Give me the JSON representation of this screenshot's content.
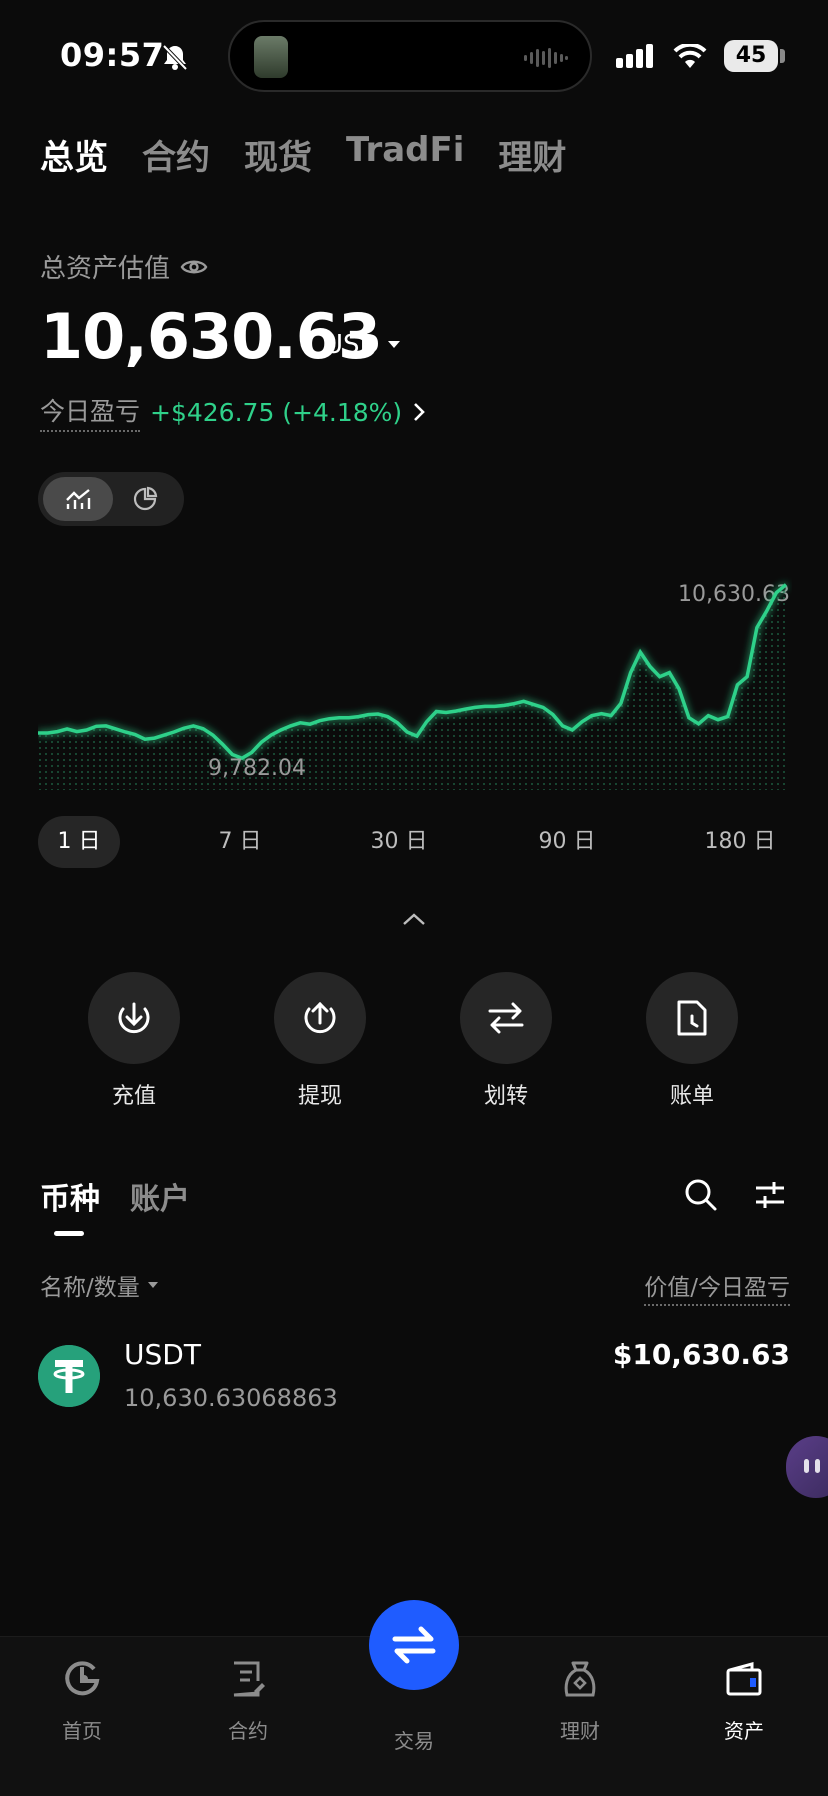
{
  "status_bar": {
    "time": "09:57",
    "battery": "45"
  },
  "top_tabs": [
    {
      "label": "总览",
      "active": true
    },
    {
      "label": "合约",
      "active": false
    },
    {
      "label": "现货",
      "active": false
    },
    {
      "label": "TradFi",
      "active": false
    },
    {
      "label": "理财",
      "active": false
    }
  ],
  "overview": {
    "total_label": "总资产估值",
    "total_value": "10,630.63",
    "currency": "USD",
    "pnl_label": "今日盈亏",
    "pnl_value": "+$426.75 (+4.18%)"
  },
  "chart_data": {
    "type": "line",
    "max_label": "10,630.63",
    "min_label": "9,782.04",
    "values": [
      9905,
      9905,
      9912,
      9925,
      9912,
      9920,
      9938,
      9940,
      9925,
      9910,
      9898,
      9875,
      9880,
      9895,
      9910,
      9928,
      9940,
      9926,
      9895,
      9850,
      9800,
      9782,
      9810,
      9860,
      9895,
      9920,
      9940,
      9955,
      9948,
      9965,
      9975,
      9980,
      9980,
      9985,
      9995,
      9998,
      9985,
      9955,
      9910,
      9890,
      9960,
      10010,
      10005,
      10012,
      10022,
      10030,
      10035,
      10035,
      10040,
      10048,
      10060,
      10045,
      10030,
      9995,
      9940,
      9920,
      9960,
      9990,
      10000,
      9990,
      10050,
      10200,
      10300,
      10230,
      10180,
      10200,
      10120,
      9980,
      9950,
      9990,
      9970,
      9985,
      10140,
      10180,
      10420,
      10500,
      10590,
      10630
    ],
    "ylim": [
      9700,
      10750
    ],
    "color": "#2fd18a"
  },
  "periods": [
    {
      "label": "1 日",
      "active": true
    },
    {
      "label": "7 日",
      "active": false
    },
    {
      "label": "30 日",
      "active": false
    },
    {
      "label": "90 日",
      "active": false
    },
    {
      "label": "180 日",
      "active": false
    }
  ],
  "actions": [
    {
      "label": "充值",
      "icon": "deposit-icon"
    },
    {
      "label": "提现",
      "icon": "withdraw-icon"
    },
    {
      "label": "划转",
      "icon": "transfer-icon"
    },
    {
      "label": "账单",
      "icon": "bill-icon"
    }
  ],
  "asset_tabs": [
    {
      "label": "币种",
      "active": true
    },
    {
      "label": "账户",
      "active": false
    }
  ],
  "list_header": {
    "left": "名称/数量",
    "right": "价值/今日盈亏"
  },
  "coins": [
    {
      "name": "USDT",
      "quantity": "10,630.63068863",
      "value": "$10,630.63",
      "icon_color": "#26a17b"
    }
  ],
  "bottom_nav": [
    {
      "label": "首页",
      "icon": "home-icon",
      "active": false
    },
    {
      "label": "合约",
      "icon": "contract-icon",
      "active": false
    },
    {
      "label": "交易",
      "icon": "trade-icon",
      "active": false
    },
    {
      "label": "理财",
      "icon": "earn-icon",
      "active": false
    },
    {
      "label": "资产",
      "icon": "wallet-icon",
      "active": true
    }
  ]
}
